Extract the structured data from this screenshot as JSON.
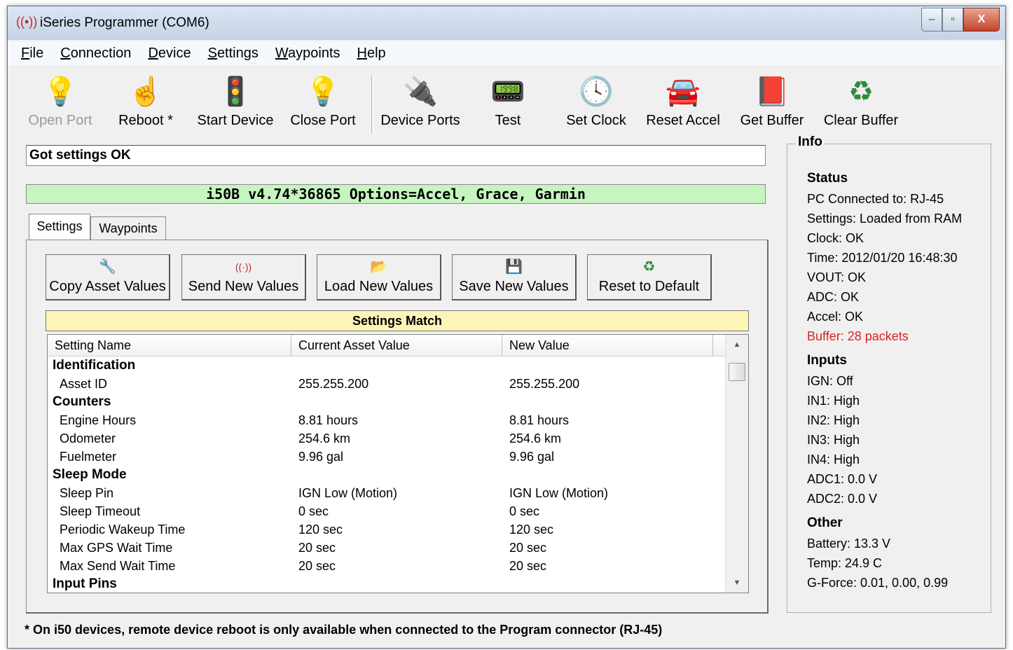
{
  "window": {
    "title": "iSeries Programmer (COM6)",
    "controls": {
      "minimize": "‒",
      "maximize": "▫",
      "close": "X"
    }
  },
  "menu": [
    {
      "label": "File",
      "accel": "F",
      "rest": "ile"
    },
    {
      "label": "Connection",
      "accel": "C",
      "rest": "onnection"
    },
    {
      "label": "Device",
      "accel": "D",
      "rest": "evice"
    },
    {
      "label": "Settings",
      "accel": "S",
      "rest": "ettings"
    },
    {
      "label": "Waypoints",
      "accel": "W",
      "rest": "aypoints"
    },
    {
      "label": "Help",
      "accel": "H",
      "rest": "elp"
    }
  ],
  "toolbar": [
    {
      "label": "Open Port",
      "icon": "lightbulb-icon",
      "glyph": "💡",
      "enabled": false
    },
    {
      "label": "Reboot *",
      "icon": "hand-pointer-icon",
      "glyph": "☝",
      "enabled": true
    },
    {
      "label": "Start Device",
      "icon": "traffic-light-icon",
      "glyph": "🚦",
      "enabled": true
    },
    {
      "label": "Close Port",
      "icon": "lightbulb-outline-icon",
      "glyph": "💡",
      "enabled": true
    },
    {
      "label": "Device Ports",
      "icon": "plug-connector-icon",
      "glyph": "🔌",
      "enabled": true
    },
    {
      "label": "Test",
      "icon": "oscilloscope-icon",
      "glyph": "📟",
      "enabled": true
    },
    {
      "label": "Set Clock",
      "icon": "clock-icon",
      "glyph": "🕓",
      "enabled": true
    },
    {
      "label": "Reset Accel",
      "icon": "car-icon",
      "glyph": "🚘",
      "enabled": true
    },
    {
      "label": "Get Buffer",
      "icon": "book-icon",
      "glyph": "📕",
      "enabled": true
    },
    {
      "label": "Clear Buffer",
      "icon": "recycle-bin-icon",
      "glyph": "♻",
      "enabled": true
    }
  ],
  "status_message": "Got settings OK",
  "device_banner": "i50B v4.74*36865 Options=Accel, Grace, Garmin",
  "tabs": {
    "settings": "Settings",
    "waypoints": "Waypoints"
  },
  "actions": [
    {
      "label": "Copy Asset Values",
      "icon": "wrench-icon",
      "glyph": "🔧"
    },
    {
      "label": "Send New Values",
      "icon": "antenna-icon",
      "glyph": "((·))"
    },
    {
      "label": "Load New Values",
      "icon": "folder-icon",
      "glyph": "📂"
    },
    {
      "label": "Save New Values",
      "icon": "floppy-disk-icon",
      "glyph": "💾"
    },
    {
      "label": "Reset to Default",
      "icon": "recycle-icon",
      "glyph": "♻"
    }
  ],
  "settings_match": "Settings Match",
  "table": {
    "headers": [
      "Setting Name",
      "Current Asset Value",
      "New Value"
    ],
    "rows": [
      {
        "category": true,
        "name": "Identification",
        "current": "",
        "new": ""
      },
      {
        "category": false,
        "name": "Asset ID",
        "current": "255.255.200",
        "new": "255.255.200"
      },
      {
        "category": true,
        "name": "Counters",
        "current": "",
        "new": ""
      },
      {
        "category": false,
        "name": "Engine Hours",
        "current": "8.81 hours",
        "new": "8.81 hours"
      },
      {
        "category": false,
        "name": "Odometer",
        "current": "254.6 km",
        "new": "254.6 km"
      },
      {
        "category": false,
        "name": "Fuelmeter",
        "current": "9.96 gal",
        "new": "9.96 gal"
      },
      {
        "category": true,
        "name": "Sleep Mode",
        "current": "",
        "new": ""
      },
      {
        "category": false,
        "name": "Sleep Pin",
        "current": "IGN Low (Motion)",
        "new": "IGN Low (Motion)"
      },
      {
        "category": false,
        "name": "Sleep Timeout",
        "current": "0 sec",
        "new": "0 sec"
      },
      {
        "category": false,
        "name": "Periodic Wakeup Time",
        "current": "120 sec",
        "new": "120 sec"
      },
      {
        "category": false,
        "name": "Max GPS Wait Time",
        "current": "20 sec",
        "new": "20 sec"
      },
      {
        "category": false,
        "name": "Max Send Wait Time",
        "current": "20 sec",
        "new": "20 sec"
      },
      {
        "category": true,
        "name": "Input Pins",
        "current": "",
        "new": ""
      }
    ]
  },
  "info": {
    "title": "Info",
    "status": {
      "heading": "Status",
      "lines": [
        {
          "text": "PC Connected to: RJ-45",
          "color": "#000000"
        },
        {
          "text": "Settings: Loaded from RAM",
          "color": "#000000"
        },
        {
          "text": "Clock: OK",
          "color": "#000000"
        },
        {
          "text": "Time: 2012/01/20 16:48:30",
          "color": "#000000"
        },
        {
          "text": "VOUT: OK",
          "color": "#000000"
        },
        {
          "text": "ADC: OK",
          "color": "#000000"
        },
        {
          "text": "Accel: OK",
          "color": "#000000"
        },
        {
          "text": "Buffer: 28 packets",
          "color": "#e02020"
        }
      ]
    },
    "inputs": {
      "heading": "Inputs",
      "lines": [
        "IGN: Off",
        "IN1: High",
        "IN2: High",
        "IN3: High",
        "IN4: High",
        "ADC1: 0.0 V",
        "ADC2: 0.0 V"
      ]
    },
    "other": {
      "heading": "Other",
      "lines": [
        "Battery: 13.3 V",
        "Temp: 24.9 C",
        "G-Force: 0.01, 0.00, 0.99"
      ]
    }
  },
  "footnote": "* On i50 devices, remote device reboot is only available when connected to the Program connector (RJ-45)"
}
